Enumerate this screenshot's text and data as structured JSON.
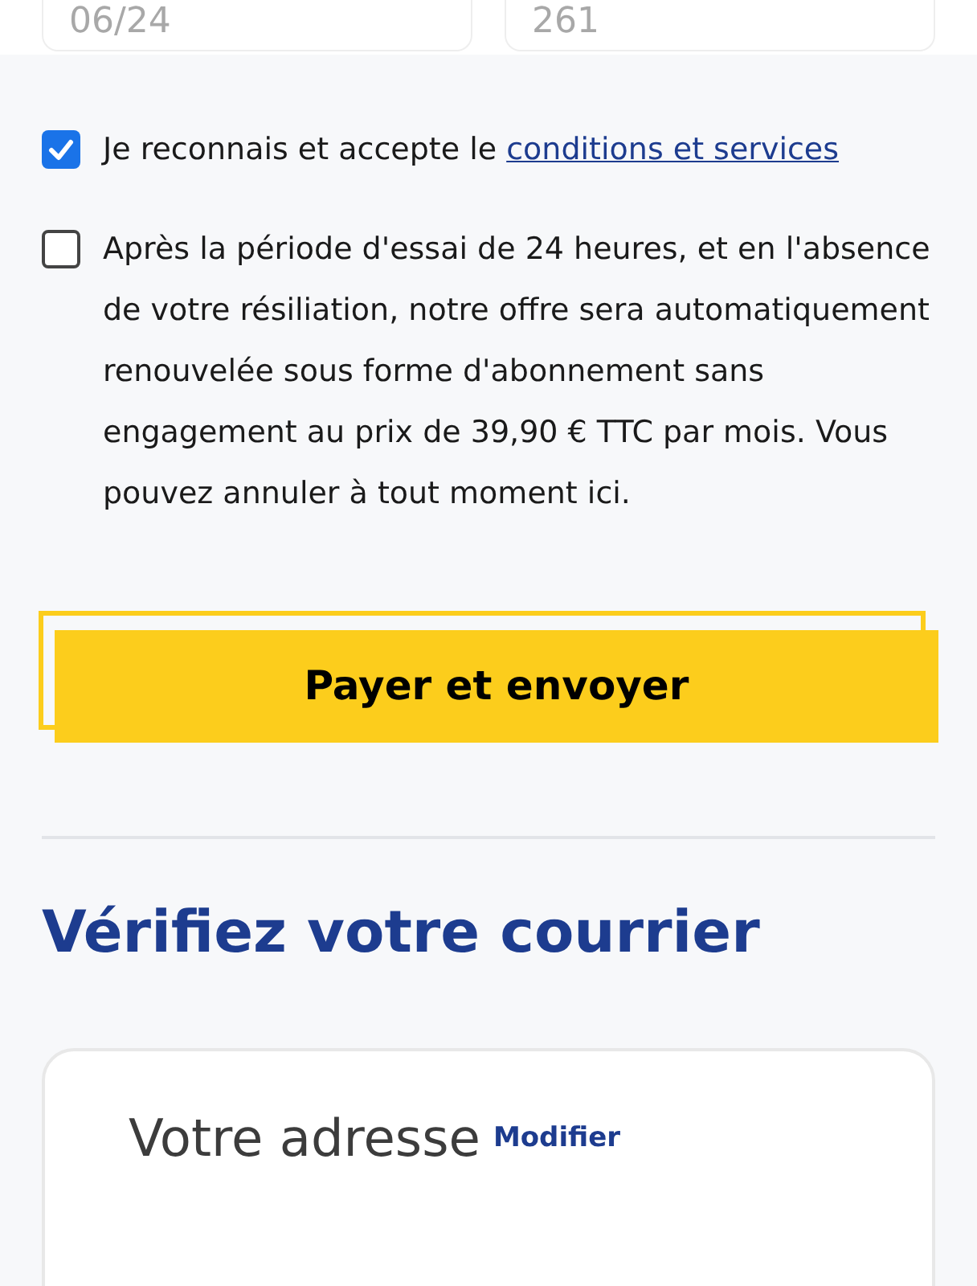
{
  "card_fields": [
    {
      "placeholder": "06/24"
    },
    {
      "placeholder": "261"
    }
  ],
  "consents": [
    {
      "checked": true,
      "text": "Je reconnais et accepte le ",
      "link": "conditions et services"
    },
    {
      "checked": false,
      "text": "Après la période d'essai de 24 heures, et en l'absence de votre résiliation, notre offre sera automatiquement renouvelée sous forme d'abonnement sans engagement au prix de 39,90 € TTC par mois. Vous pouvez annuler à tout moment ici."
    }
  ],
  "pay_button": "Payer et envoyer",
  "section_title": "Vérifiez votre courrier",
  "address_card": {
    "title": "Votre adresse",
    "edit_link": "Modifier"
  }
}
